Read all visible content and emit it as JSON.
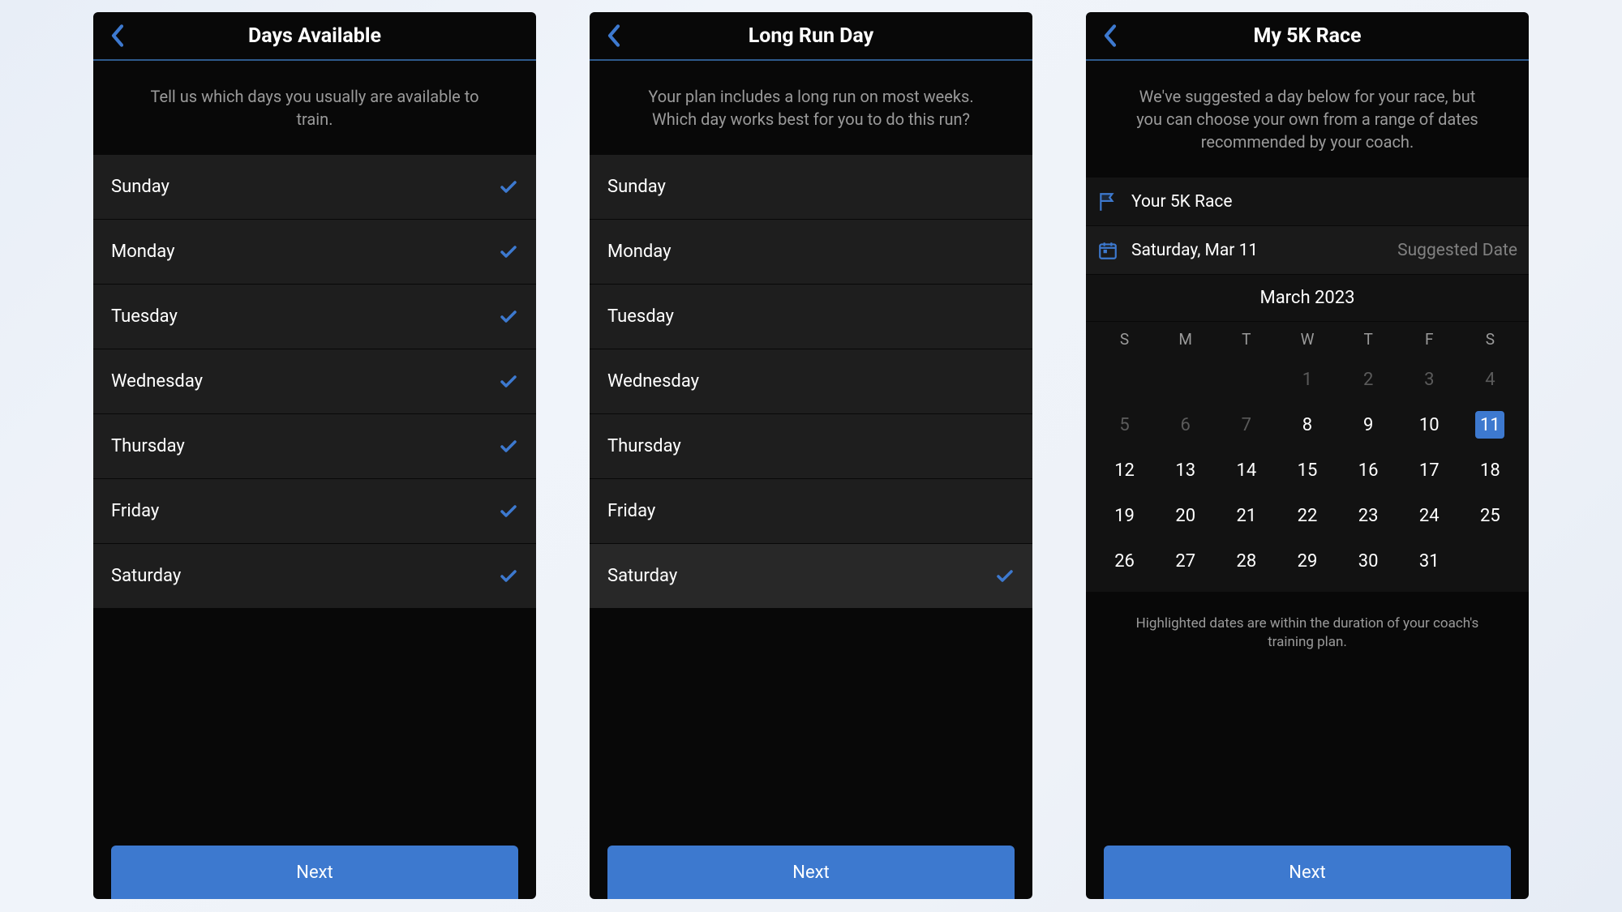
{
  "colors": {
    "accent": "#3d79cf"
  },
  "next_label": "Next",
  "screen1": {
    "title": "Days Available",
    "subtitle": "Tell us which days you usually are available to train.",
    "days": [
      {
        "label": "Sunday",
        "checked": true
      },
      {
        "label": "Monday",
        "checked": true
      },
      {
        "label": "Tuesday",
        "checked": true
      },
      {
        "label": "Wednesday",
        "checked": true
      },
      {
        "label": "Thursday",
        "checked": true
      },
      {
        "label": "Friday",
        "checked": true
      },
      {
        "label": "Saturday",
        "checked": true
      }
    ]
  },
  "screen2": {
    "title": "Long Run Day",
    "subtitle": "Your plan includes a long run on most weeks. Which day works best for you to do this run?",
    "days": [
      {
        "label": "Sunday",
        "selected": false
      },
      {
        "label": "Monday",
        "selected": false
      },
      {
        "label": "Tuesday",
        "selected": false
      },
      {
        "label": "Wednesday",
        "selected": false
      },
      {
        "label": "Thursday",
        "selected": false
      },
      {
        "label": "Friday",
        "selected": false
      },
      {
        "label": "Saturday",
        "selected": true
      }
    ]
  },
  "screen3": {
    "title": "My 5K Race",
    "subtitle": "We've suggested a day below for your race, but you can choose your own from a range of dates recommended by your coach.",
    "race_label": "Your 5K Race",
    "date_label": "Saturday, Mar 11",
    "suggested": "Suggested Date",
    "month": "March 2023",
    "weekday_heads": [
      "S",
      "M",
      "T",
      "W",
      "T",
      "F",
      "S"
    ],
    "weeks": [
      [
        {
          "d": ""
        },
        {
          "d": ""
        },
        {
          "d": ""
        },
        {
          "d": "1",
          "dim": true
        },
        {
          "d": "2",
          "dim": true
        },
        {
          "d": "3",
          "dim": true
        },
        {
          "d": "4",
          "dim": true
        }
      ],
      [
        {
          "d": "5",
          "dim": true
        },
        {
          "d": "6",
          "dim": true
        },
        {
          "d": "7",
          "dim": true
        },
        {
          "d": "8"
        },
        {
          "d": "9"
        },
        {
          "d": "10"
        },
        {
          "d": "11",
          "sel": true
        }
      ],
      [
        {
          "d": "12"
        },
        {
          "d": "13"
        },
        {
          "d": "14"
        },
        {
          "d": "15"
        },
        {
          "d": "16"
        },
        {
          "d": "17"
        },
        {
          "d": "18"
        }
      ],
      [
        {
          "d": "19"
        },
        {
          "d": "20"
        },
        {
          "d": "21"
        },
        {
          "d": "22"
        },
        {
          "d": "23"
        },
        {
          "d": "24"
        },
        {
          "d": "25"
        }
      ],
      [
        {
          "d": "26"
        },
        {
          "d": "27"
        },
        {
          "d": "28"
        },
        {
          "d": "29"
        },
        {
          "d": "30"
        },
        {
          "d": "31"
        },
        {
          "d": ""
        }
      ]
    ],
    "footer_note": "Highlighted dates are within the duration of your coach's training plan."
  }
}
